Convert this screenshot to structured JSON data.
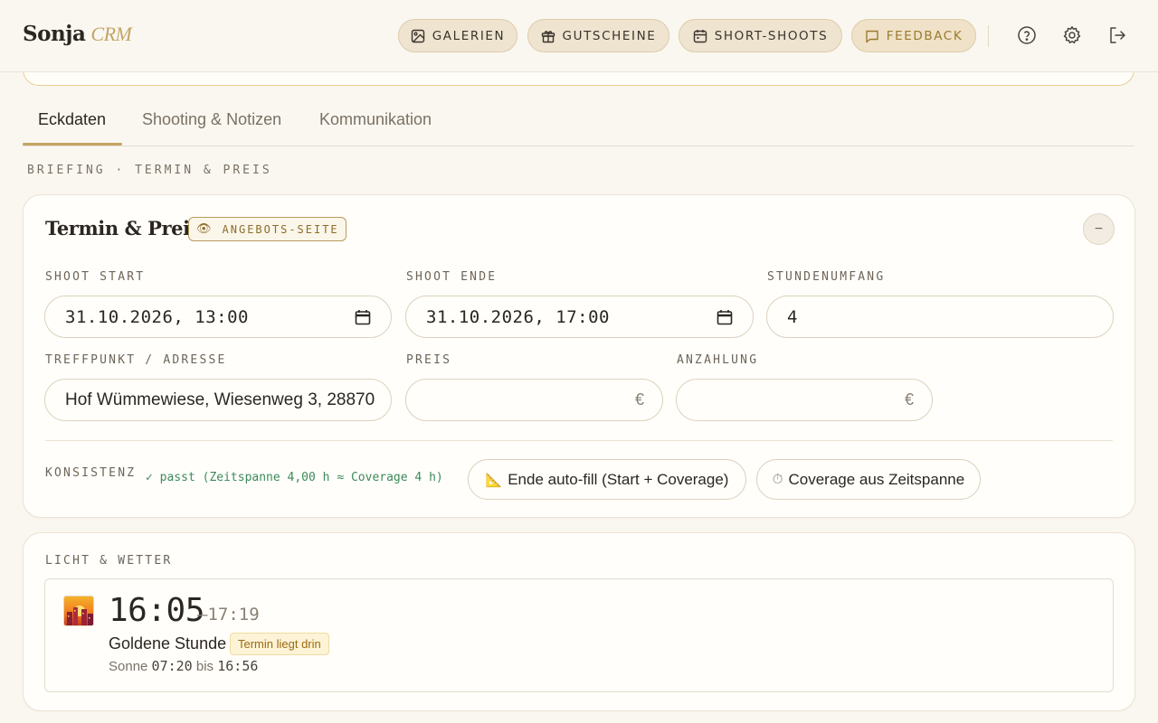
{
  "app": {
    "brand_name": "Sonja",
    "brand_suffix": "CRM"
  },
  "nav": {
    "galerien": "GALERIEN",
    "gutscheine": "GUTSCHEINE",
    "short_shoots": "SHORT-SHOOTS",
    "feedback": "FEEDBACK"
  },
  "header_icons": [
    "help-icon",
    "gear-icon",
    "logout-icon"
  ],
  "tabs": [
    {
      "label": "Eckdaten",
      "active": true
    },
    {
      "label": "Shooting & Notizen",
      "active": false
    },
    {
      "label": "Kommunikation",
      "active": false
    }
  ],
  "section_label": "BRIEFING · TERMIN & PREIS",
  "termin": {
    "title": "Termin & Preis",
    "badge": "ANGEBOTS-SEITE",
    "collapse": "−",
    "shoot_start_label": "SHOOT START",
    "shoot_start": "31.10.2026, 13:00",
    "shoot_ende_label": "SHOOT ENDE",
    "shoot_ende": "31.10.2026, 17:00",
    "stunden_label": "STUNDENUMFANG",
    "stunden": "4",
    "treffpunkt_label": "TREFFPUNKT / ADRESSE",
    "treffpunkt": "Hof Wümmewiese, Wiesenweg 3, 28870",
    "preis_label": "PREIS",
    "preis": "",
    "anzahlung_label": "ANZAHLUNG",
    "anzahlung": "",
    "currency": "€",
    "konsistenz_label": "KONSISTENZ",
    "konsistenz_status": "✓ passt (Zeitspanne 4,00 h ≈ Coverage 4 h)",
    "btn_autofill": "Ende auto-fill (Start + Coverage)",
    "btn_coverage": "Coverage aus Zeitspanne"
  },
  "licht": {
    "label": "LICHT & WETTER",
    "golden_start": "16:05",
    "golden_end": "–17:19",
    "golden_label": "Goldene Stunde",
    "golden_chip": "Termin liegt drin",
    "sun_prefix": "Sonne",
    "sunrise": "07:20",
    "sun_mid": "bis",
    "sunset": "16:56"
  },
  "colors": {
    "accent": "#c4a463",
    "ok": "#3d8a5a",
    "background": "#faf7f1"
  }
}
